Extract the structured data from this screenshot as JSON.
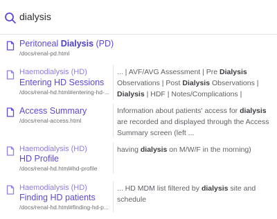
{
  "search": {
    "query": "dialysis"
  },
  "results": [
    {
      "title_pre": "Peritoneal ",
      "title_bold": "Dialysis",
      "title_post": " (PD)",
      "path": "/docs/renal-pd.html"
    },
    {
      "crumb": "Haemodialysis (HD)",
      "title": "Entering HD Sessions",
      "path": "/docs/renal-hd.html#entering-hd-...",
      "excerpt": [
        {
          "t": "... | AVF/AVG Assessment | Pre "
        },
        {
          "b": "Dialysis"
        },
        {
          "t": " Observations | Post "
        },
        {
          "b": "Dialysis"
        },
        {
          "t": " Observations | "
        },
        {
          "b": "Dialysis"
        },
        {
          "t": " | HDF | Notes/Complications |"
        }
      ]
    },
    {
      "title": "Access Summary",
      "path": "/docs/renal-access.html",
      "excerpt": [
        {
          "t": "Information about patients' access for "
        },
        {
          "b": "dialysis"
        },
        {
          "t": " are recorded and displayed through the Access Summary screen (left ..."
        }
      ]
    },
    {
      "crumb": "Haemodialysis (HD)",
      "title": "HD Profile",
      "path": "/docs/renal-hd.html#hd-profile",
      "excerpt": [
        {
          "t": "having "
        },
        {
          "b": "dialysis"
        },
        {
          "t": " on M/W/F in the morning)"
        }
      ]
    },
    {
      "crumb": "Haemodialysis (HD)",
      "title": "Finding HD patients",
      "path": "/docs/renal-hd.html#finding-hd-p...",
      "excerpt": [
        {
          "t": "... HD MDM list filtered by "
        },
        {
          "b": "dialysis"
        },
        {
          "t": " site and schedule"
        }
      ]
    }
  ]
}
